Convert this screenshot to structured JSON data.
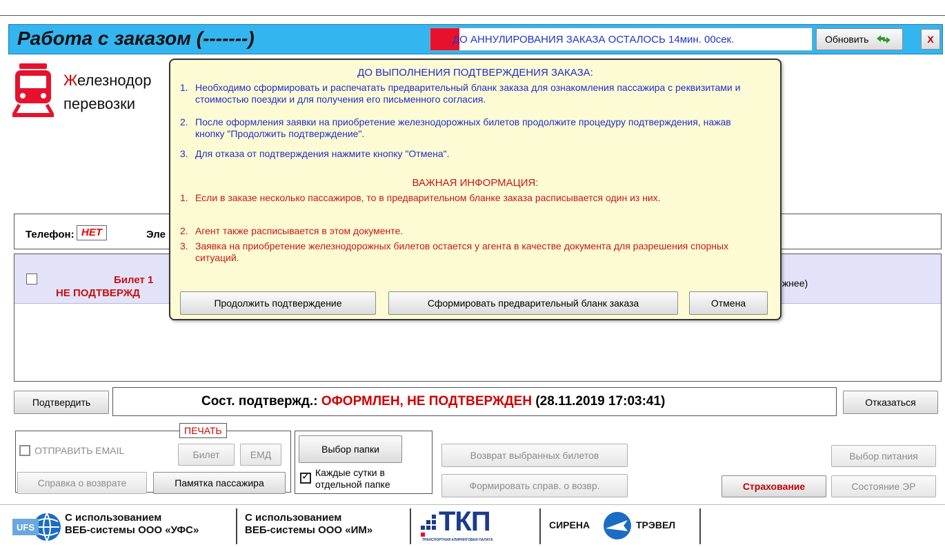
{
  "window": {
    "title": "Работа с заказом (-------)",
    "timer_text": "ДО АННУЛИРОВАНИЯ ЗАКАЗА ОСТАЛОСЬ 14мин. 00сек.",
    "refresh_label": "Обновить",
    "close_label": "X"
  },
  "service": {
    "title_first_letter": "Ж",
    "title_line1_rest": "елезнодор",
    "title_line2": "перевозки"
  },
  "contacts": {
    "phone_label": "Телефон:",
    "phone_value": "НЕТ",
    "email_label": "Эле"
  },
  "tickets": [
    {
      "label": "Билет 1",
      "status": "НЕ ПОДТВЕРЖД",
      "seat_tail": "ижнее)"
    }
  ],
  "confirm_bar": {
    "confirm_label": "Подтвердить",
    "status_prefix": "Сост. подтвержд.:",
    "status_value": "ОФОРМЛЕН, НЕ ПОДТВЕРЖДЕН",
    "status_time": "(28.11.2019 17:03:41)",
    "refuse_label": "Отказаться"
  },
  "bottom": {
    "print_legend": "ПЕЧАТЬ",
    "send_email_label": "ОТПРАВИТЬ EMAIL",
    "ticket_btn": "Билет",
    "emd_btn": "ЕМД",
    "refund_cert_btn": "Справка о возврате",
    "passenger_memo_btn": "Памятка пассажира",
    "choose_folder_btn": "Выбор папки",
    "daily_folder_label_1": "Каждые сутки в",
    "daily_folder_label_2": "отдельной папке",
    "return_selected_btn": "Возврат выбранных билетов",
    "form_refund_btn": "Формировать справ. о возвр.",
    "insurance_btn": "Страхование",
    "meal_btn": "Выбор питания",
    "er_state_btn": "Состояние ЭР"
  },
  "footer": {
    "ufs_line1": "С использованием",
    "ufs_line2": "ВЕБ-системы ООО «УФС»",
    "im_line1": "С использованием",
    "im_line2": "ВЕБ-системы ООО «ИМ»",
    "tkp_logo": "ТКП",
    "tkp_sub": "ТРАНСПОРТНАЯ КЛИРИНГОВАЯ ПАЛАТА",
    "sirena_left": "СИРЕНА",
    "sirena_right": "ТРЭВЕЛ",
    "ufs_logo": "UFS"
  },
  "modal": {
    "heading1": "ДО ВЫПОЛНЕНИЯ ПОДТВЕРЖДЕНИЯ ЗАКАЗА:",
    "items1": [
      {
        "num": "1.",
        "text": "Необходимо сформировать и распечатать предварительный бланк заказа для ознакомления пассажира с реквизитами и стоимостью поездки и для получения его письменного согласия."
      },
      {
        "num": "2.",
        "text": "После оформления заявки на приобретение железнодорожных билетов продолжите процедуру подтверждения, нажав кнопку \"Продолжить подтверждение\"."
      },
      {
        "num": "3.",
        "text": "Для отказа от подтверждения нажмите кнопку \"Отмена\"."
      }
    ],
    "heading2": "ВАЖНАЯ ИНФОРМАЦИЯ:",
    "items2": [
      {
        "num": "1.",
        "text": "Если в заказе несколько пассажиров, то в предварительном бланке заказа расписывается один из них."
      },
      {
        "num": "2.",
        "text": "Агент также расписывается в этом документе."
      },
      {
        "num": "3.",
        "text": "Заявка на приобретение железнодорожных билетов остается у агента в качестве документа для разрешения спорных ситуаций."
      }
    ],
    "continue_btn": "Продолжить подтверждение",
    "form_blank_btn": "Сформировать предварительный бланк заказа",
    "cancel_btn": "Отмена"
  },
  "colors": {
    "titlebar": "#33b5f0",
    "modal_bg": "#fdfbd3",
    "accent_red": "#d00000",
    "modal_blue": "#1f2ecb"
  }
}
